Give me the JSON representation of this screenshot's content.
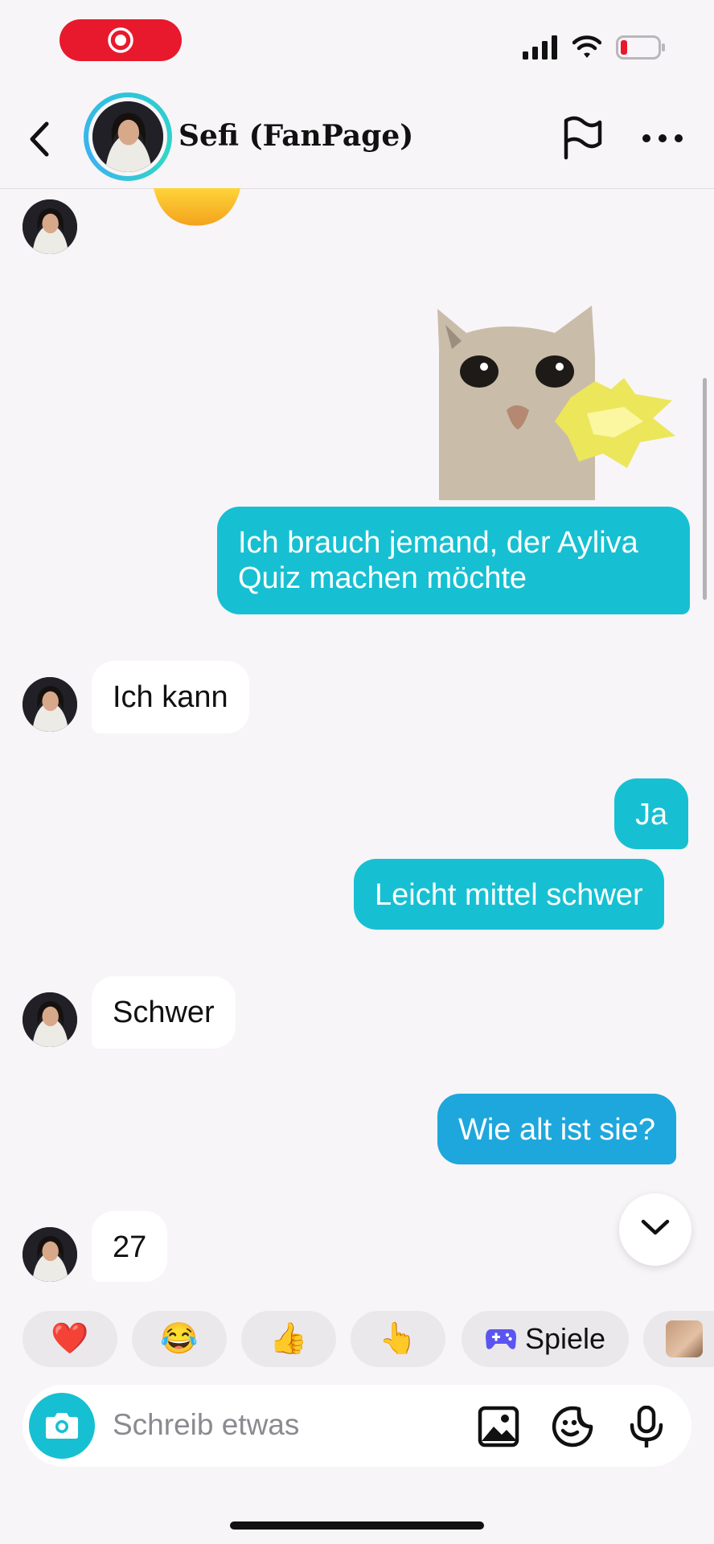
{
  "header": {
    "title": "Sefi (FanPage)"
  },
  "messages": [
    {
      "side": "out",
      "text": "Ich brauch jemand, der Ayliva\nQuiz machen möchte"
    },
    {
      "side": "in",
      "text": "Ich kann"
    },
    {
      "side": "out",
      "text": "Ja"
    },
    {
      "side": "out",
      "text": "Leicht mittel schwer"
    },
    {
      "side": "in",
      "text": "Schwer"
    },
    {
      "side": "out",
      "text": "Wie alt ist sie?"
    },
    {
      "side": "in",
      "text": "27"
    }
  ],
  "quick_replies": [
    {
      "type": "emoji",
      "icon": "heart-icon",
      "glyph": "❤️"
    },
    {
      "type": "emoji",
      "icon": "tears-of-joy-icon",
      "glyph": "😂"
    },
    {
      "type": "emoji",
      "icon": "thumbs-up-icon",
      "glyph": "👍"
    },
    {
      "type": "emoji",
      "icon": "pointing-up-icon",
      "glyph": "👆"
    },
    {
      "type": "label",
      "icon": "gamepad-icon",
      "label": "Spiele"
    }
  ],
  "composer": {
    "placeholder": "Schreib etwas"
  },
  "colors": {
    "outgoing": "#16c0d2",
    "outgoing_alt": "#1ea7dc",
    "incoming": "#ffffff",
    "background": "#f7f5f8",
    "record": "#e8192c"
  }
}
